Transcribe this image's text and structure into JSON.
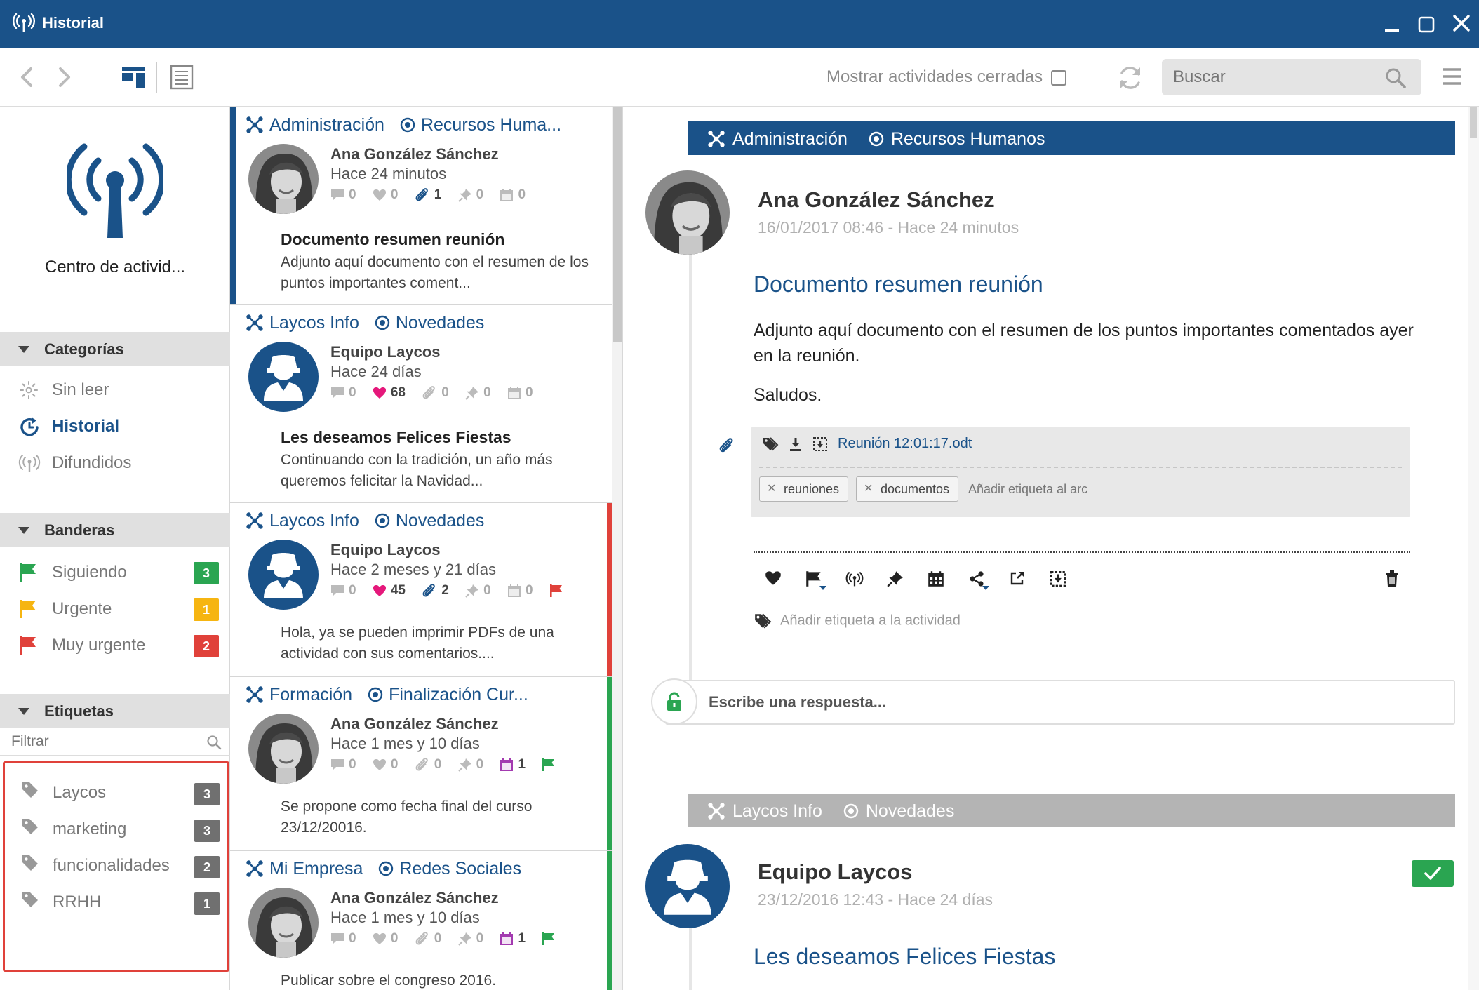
{
  "window": {
    "title": "Historial",
    "app_icon": "broadcast-icon",
    "accent": "#1a5289"
  },
  "toolbar": {
    "show_closed_label": "Mostrar actividades cerradas",
    "search_placeholder": "Buscar"
  },
  "sidebar": {
    "center_title": "Centro de activid...",
    "categories_label": "Categorías",
    "categories": [
      {
        "label": "Sin leer",
        "icon": "sun-icon",
        "active": false
      },
      {
        "label": "Historial",
        "icon": "history-icon",
        "active": true
      },
      {
        "label": "Difundidos",
        "icon": "broadcast-icon",
        "active": false
      }
    ],
    "flags_label": "Banderas",
    "flags": [
      {
        "label": "Siguiendo",
        "count": "3",
        "color": "#2aa551"
      },
      {
        "label": "Urgente",
        "count": "1",
        "color": "#f6b511"
      },
      {
        "label": "Muy urgente",
        "count": "2",
        "color": "#e0413a"
      }
    ],
    "tags_label": "Etiquetas",
    "filter_placeholder": "Filtrar",
    "tags": [
      {
        "label": "Laycos",
        "count": "3"
      },
      {
        "label": "marketing",
        "count": "3"
      },
      {
        "label": "funcionalidades",
        "count": "2"
      },
      {
        "label": "RRHH",
        "count": "1"
      }
    ]
  },
  "list": {
    "cards": [
      {
        "group": "Administración",
        "channel": "Recursos Huma...",
        "author": "Ana González Sánchez",
        "time": "Hace 24 minutos",
        "avatar": "woman",
        "stats": {
          "comments": "0",
          "likes": "0",
          "attachments": "1",
          "pins": "0",
          "events": "0"
        },
        "title": "Documento resumen reunión",
        "body": "Adjunto aquí documento con el resumen de los puntos importantes coment...",
        "stripe": "#1a5289"
      },
      {
        "group": "Laycos Info",
        "channel": "Novedades",
        "author": "Equipo Laycos",
        "time": "Hace 24 días",
        "avatar": "team",
        "stats": {
          "comments": "0",
          "likes": "68",
          "attachments": "0",
          "pins": "0",
          "events": "0"
        },
        "title": "Les deseamos Felices Fiestas",
        "body": "Continuando con la tradición, un año más queremos felicitar la Navidad..."
      },
      {
        "group": "Laycos Info",
        "channel": "Novedades",
        "author": "Equipo Laycos",
        "time": "Hace 2 meses y 21 días",
        "avatar": "team",
        "stats": {
          "comments": "0",
          "likes": "45",
          "attachments": "2",
          "pins": "0",
          "events": "0"
        },
        "title": "",
        "body": "Hola, ya se pueden imprimir PDFs de una actividad con sus comentarios....",
        "stripe": "#e0413a",
        "flag": "#e0413a"
      },
      {
        "group": "Formación",
        "channel": "Finalización Cur...",
        "author": "Ana González Sánchez",
        "time": "Hace 1 mes y 10 días",
        "avatar": "woman",
        "stats": {
          "comments": "0",
          "likes": "0",
          "attachments": "0",
          "pins": "0",
          "events": "1"
        },
        "title": "",
        "body": "Se propone como fecha final del curso 23/12/20016.",
        "stripe": "#2aa551",
        "flag": "#2aa551"
      },
      {
        "group": "Mi Empresa",
        "channel": "Redes Sociales",
        "author": "Ana González Sánchez",
        "time": "Hace 1 mes y 10 días",
        "avatar": "woman",
        "stats": {
          "comments": "0",
          "likes": "0",
          "attachments": "0",
          "pins": "0",
          "events": "1"
        },
        "title": "",
        "body": "Publicar sobre el congreso 2016.",
        "stripe": "#2aa551",
        "flag": "#2aa551"
      }
    ]
  },
  "detail": {
    "activity1": {
      "group": "Administración",
      "channel": "Recursos Humanos",
      "author": "Ana González Sánchez",
      "date": "16/01/2017 08:46 - Hace 24 minutos",
      "title": "Documento resumen reunión",
      "paragraph1": "Adjunto aquí documento con el resumen de los puntos importantes comentados ayer en la reunión.",
      "paragraph2": "Saludos.",
      "attachment_name": "Reunión 12:01:17.odt",
      "attachment_tags": [
        "reuniones",
        "documentos"
      ],
      "attachment_tag_placeholder": "Añadir etiqueta al arc",
      "add_tag_label": "Añadir etiqueta a la actividad",
      "reply_placeholder": "Escribe una respuesta..."
    },
    "activity2": {
      "group": "Laycos Info",
      "channel": "Novedades",
      "author": "Equipo Laycos",
      "date": "23/12/2016 12:43 - Hace 24 días",
      "title": "Les deseamos Felices Fiestas"
    }
  }
}
